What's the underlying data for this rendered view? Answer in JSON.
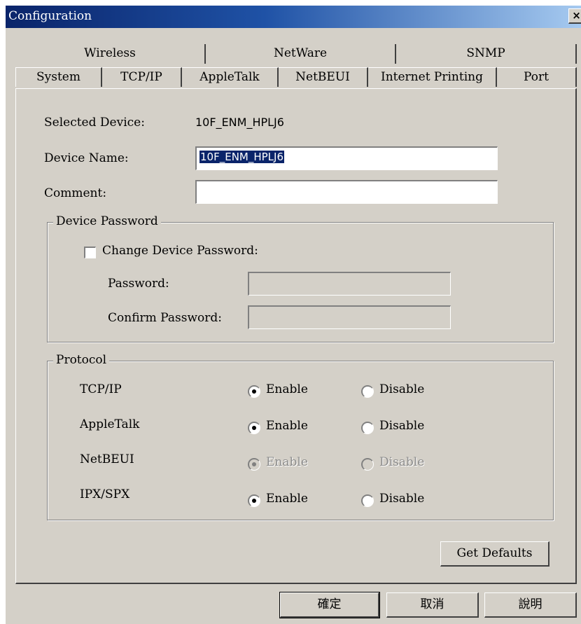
{
  "window": {
    "title": "Configuration",
    "close_glyph": "×"
  },
  "tabs": {
    "top_row": [
      "Wireless",
      "NetWare",
      "SNMP"
    ],
    "bottom_row": [
      "System",
      "TCP/IP",
      "AppleTalk",
      "NetBEUI",
      "Internet Printing",
      "Port"
    ],
    "active": "System"
  },
  "system": {
    "selected_device_label": "Selected Device:",
    "selected_device_value": "10F_ENM_HPLJ6",
    "device_name_label": "Device Name:",
    "device_name_value": "10F_ENM_HPLJ6",
    "comment_label": "Comment:",
    "comment_value": ""
  },
  "device_password": {
    "group_title": "Device Password",
    "change_label": "Change Device Password:",
    "change_checked": false,
    "password_label": "Password:",
    "confirm_label": "Confirm Password:"
  },
  "protocol": {
    "group_title": "Protocol",
    "enable_label": "Enable",
    "disable_label": "Disable",
    "rows": [
      {
        "name": "TCP/IP",
        "state": "enable",
        "disabled": false
      },
      {
        "name": "AppleTalk",
        "state": "enable",
        "disabled": false
      },
      {
        "name": "NetBEUI",
        "state": "enable",
        "disabled": true
      },
      {
        "name": "IPX/SPX",
        "state": "enable",
        "disabled": false
      }
    ]
  },
  "buttons": {
    "get_defaults": "Get Defaults",
    "ok": "確定",
    "cancel": "取消",
    "help": "說明"
  }
}
